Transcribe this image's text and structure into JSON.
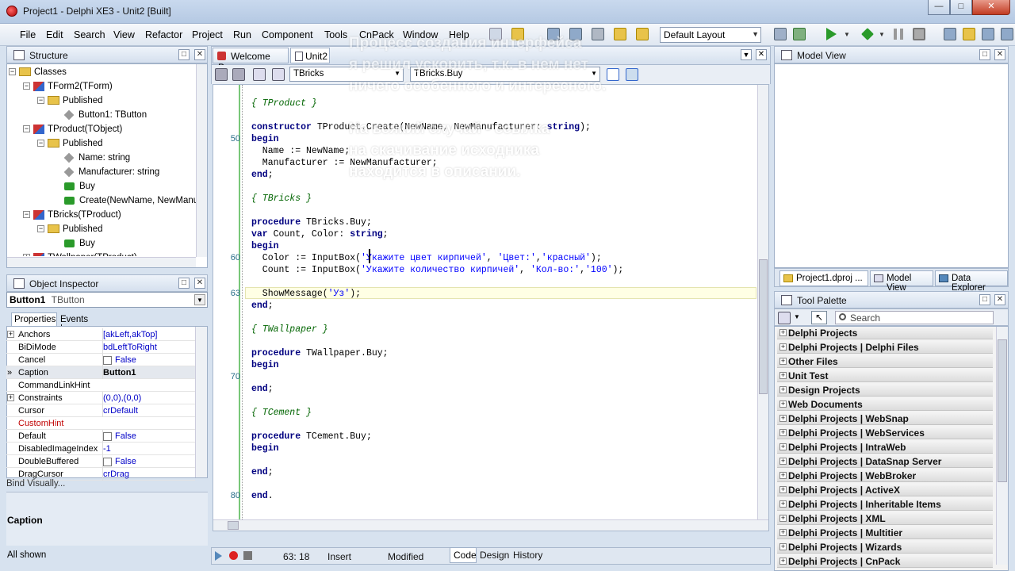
{
  "window": {
    "title": "Project1 - Delphi XE3 - Unit2 [Built]"
  },
  "menu": [
    "File",
    "Edit",
    "Search",
    "View",
    "Refactor",
    "Project",
    "Run",
    "Component",
    "Tools",
    "CnPack",
    "Window",
    "Help"
  ],
  "layout_select": "Default Layout",
  "structure": {
    "title": "Structure",
    "items": [
      {
        "label": "Classes",
        "icon": "folder-icon"
      },
      {
        "label": "TForm2(TForm)",
        "icon": "class-icon"
      },
      {
        "label": "Published",
        "icon": "folder-icon"
      },
      {
        "label": "Button1: TButton",
        "icon": "field-icon"
      },
      {
        "label": "TProduct(TObject)",
        "icon": "class-icon"
      },
      {
        "label": "Published",
        "icon": "folder-icon"
      },
      {
        "label": "Name: string",
        "icon": "field-icon"
      },
      {
        "label": "Manufacturer: string",
        "icon": "field-icon"
      },
      {
        "label": "Buy",
        "icon": "method-icon"
      },
      {
        "label": "Create(NewName, NewManuf",
        "icon": "method-icon"
      },
      {
        "label": "TBricks(TProduct)",
        "icon": "class-icon"
      },
      {
        "label": "Published",
        "icon": "folder-icon"
      },
      {
        "label": "Buy",
        "icon": "method-icon"
      },
      {
        "label": "TWallpaper(TProduct)",
        "icon": "class-icon"
      }
    ]
  },
  "object_inspector": {
    "title": "Object Inspector",
    "selected_name": "Button1",
    "selected_type": "TButton",
    "tabs": [
      "Properties",
      "Events"
    ],
    "rows": [
      {
        "key": "Anchors",
        "value": "[akLeft,akTop]"
      },
      {
        "key": "BiDiMode",
        "value": "bdLeftToRight"
      },
      {
        "key": "Cancel",
        "value": "False"
      },
      {
        "key": "Caption",
        "value": "Button1"
      },
      {
        "key": "CommandLinkHint",
        "value": ""
      },
      {
        "key": "Constraints",
        "value": "(0,0),(0,0)"
      },
      {
        "key": "Cursor",
        "value": "crDefault"
      },
      {
        "key": "CustomHint",
        "value": ""
      },
      {
        "key": "Default",
        "value": "False"
      },
      {
        "key": "DisabledImageIndex",
        "value": "-1"
      },
      {
        "key": "DoubleBuffered",
        "value": "False"
      },
      {
        "key": "DragCursor",
        "value": "crDrag"
      }
    ],
    "bind_visually": "Bind Visually...",
    "description_label": "Caption",
    "status": "All shown"
  },
  "editor": {
    "tabs": [
      "Welcome Page",
      "Unit2"
    ],
    "class_combo": "TBricks",
    "method_combo": "TBricks.Buy",
    "line_numbers": [
      "50",
      "60",
      "63",
      "70",
      "80"
    ],
    "lines": [
      "{ TProduct }",
      "",
      "constructor TProduct.Create(NewName, NewManufacturer: string);",
      "begin",
      "  Name := NewName;",
      "  Manufacturer := NewManufacturer;",
      "end;",
      "",
      "{ TBricks }",
      "",
      "procedure TBricks.Buy;",
      "var Count, Color: string;",
      "begin",
      "  Color := InputBox('Укажите цвет кирпичей', 'Цвет:','красный');",
      "  Count := InputBox('Укажите количество кирпичей', 'Кол-во:','100');",
      "",
      "  ShowMessage('Уз');",
      "end;",
      "",
      "{ TWallpaper }",
      "",
      "procedure TWallpaper.Buy;",
      "begin",
      "",
      "end;",
      "",
      "{ TCement }",
      "",
      "procedure TCement.Buy;",
      "begin",
      "",
      "end;",
      "",
      "end."
    ],
    "status_position": "63: 18",
    "status_mode": "Insert",
    "status_modified": "Modified",
    "bottom_tabs": [
      "Code",
      "Design",
      "History"
    ]
  },
  "overlay": [
    "Процесс создания интерфейса",
    "я решил ускорить, т.к. в нем нет",
    "ничего особенного и интересного.",
    "На всякий случай - ссылка",
    "на скачивание исходника",
    "находится в описании."
  ],
  "model_view": {
    "title": "Model View",
    "tabs": [
      "Project1.dproj ...",
      "Model View",
      "Data Explorer"
    ]
  },
  "tool_palette": {
    "title": "Tool Palette",
    "search_placeholder": "Search",
    "categories": [
      "Delphi Projects",
      "Delphi Projects | Delphi Files",
      "Other Files",
      "Unit Test",
      "Design Projects",
      "Web Documents",
      "Delphi Projects | WebSnap",
      "Delphi Projects | WebServices",
      "Delphi Projects | IntraWeb",
      "Delphi Projects | DataSnap Server",
      "Delphi Projects | WebBroker",
      "Delphi Projects | ActiveX",
      "Delphi Projects | Inheritable Items",
      "Delphi Projects | XML",
      "Delphi Projects | Multitier",
      "Delphi Projects | Wizards",
      "Delphi Projects | CnPack"
    ]
  }
}
